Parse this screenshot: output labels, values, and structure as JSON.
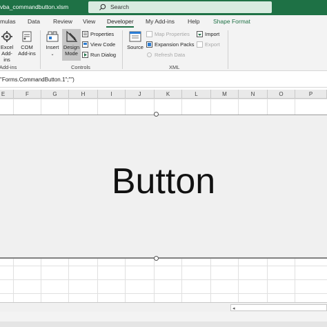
{
  "window": {
    "title": "vba_commandbutton.xlsm",
    "search_placeholder": "Search"
  },
  "tabs": [
    {
      "label": "mulas"
    },
    {
      "label": "Data"
    },
    {
      "label": "Review"
    },
    {
      "label": "View"
    },
    {
      "label": "Developer"
    },
    {
      "label": "My Add-ins"
    },
    {
      "label": "Help"
    },
    {
      "label": "Shape Format"
    }
  ],
  "ribbon": {
    "addins_group": {
      "excel_addins": "Excel\nAdd-ins",
      "excel_addins_line1": "Excel",
      "excel_addins_line2": "Add-ins",
      "com_addins_line1": "COM",
      "com_addins_line2": "Add-ins",
      "label": "Add-ins"
    },
    "controls_group": {
      "insert": "Insert",
      "design_mode_line1": "Design",
      "design_mode_line2": "Mode",
      "properties": "Properties",
      "view_code": "View Code",
      "run_dialog": "Run Dialog",
      "label": "Controls"
    },
    "xml_group": {
      "source": "Source",
      "map_properties": "Map Properties",
      "expansion_packs": "Expansion Packs",
      "refresh_data": "Refresh Data",
      "import": "Import",
      "export": "Export",
      "label": "XML"
    }
  },
  "formula_bar": {
    "text": "\"Forms.CommandButton.1\";\"\")"
  },
  "columns": [
    "E",
    "F",
    "G",
    "H",
    "I",
    "J",
    "K",
    "L",
    "M",
    "N",
    "O",
    "P"
  ],
  "command_button": {
    "caption": "Button"
  },
  "colors": {
    "title_bar": "#1e7145",
    "accent": "#1e7145",
    "ribbon_bg": "#f3f3f3",
    "button_face": "#f0f0f0"
  }
}
